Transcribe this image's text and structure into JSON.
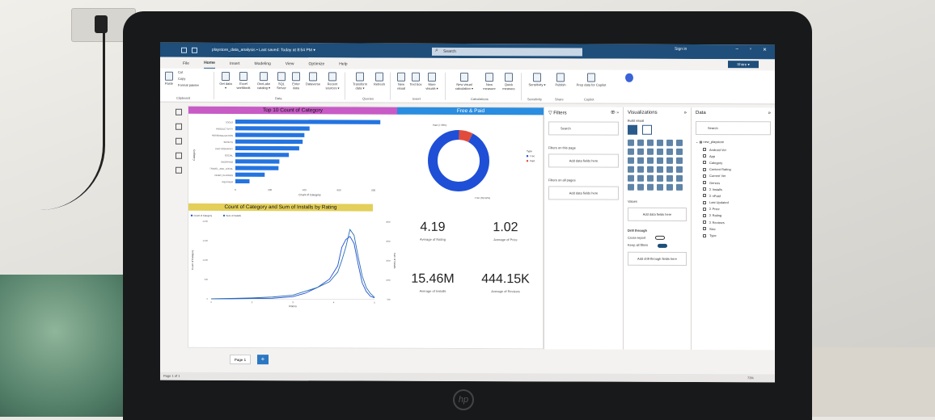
{
  "window": {
    "title": "playstore_data_analysis • Last saved: Today at 8:54 PM ▾",
    "search_placeholder": "Search",
    "sign_in": "Sign in",
    "share_label": "Share ▾"
  },
  "tabs": [
    "File",
    "Home",
    "Insert",
    "Modeling",
    "View",
    "Optimize",
    "Help"
  ],
  "ribbon": {
    "clipboard": [
      "Cut",
      "Copy",
      "Format painter",
      "Paste"
    ],
    "data_buttons": [
      "Get data ▾",
      "Excel workbook",
      "OneLake catalog ▾",
      "SQL Server",
      "Enter data",
      "Dataverse",
      "Recent sources ▾"
    ],
    "queries_buttons": [
      "Transform data ▾",
      "Refresh"
    ],
    "insert_buttons": [
      "New visual",
      "Text box",
      "More visuals ▾"
    ],
    "calc_buttons": [
      "New visual calculation ▾",
      "New measure",
      "Quick measure"
    ],
    "other_buttons": [
      "Sensitivity ▾",
      "Publish",
      "Prep data for Copilot"
    ],
    "groups": [
      "Clipboard",
      "Data",
      "Queries",
      "Insert",
      "Calculations",
      "Sensitivity",
      "Share",
      "Copilot"
    ]
  },
  "canvas": {
    "bar_title": "Top 10 Count of Category",
    "donut_title": "Free & Paid",
    "line_title": "Count of Category and Sum of Installs by Rating",
    "donut_labels": {
      "paid": "Paid (7.38%)",
      "free": "Free (92.62%)",
      "legend_title": "Type",
      "legend_free": "Free",
      "legend_paid": "Paid"
    },
    "bar_axis_x": "Count of Category",
    "bar_axis_y": "Category",
    "line_axis_x": "Rating",
    "line_axis_y": "Count of Category",
    "line_axis_y2": "Sum of Installs",
    "line_legend": [
      "Count of Category",
      "Sum of Installs"
    ],
    "kpis": [
      {
        "value": "4.19",
        "label": "Average of Rating"
      },
      {
        "value": "1.02",
        "label": "Average of Price"
      },
      {
        "value": "15.46M",
        "label": "Average of Installs"
      },
      {
        "value": "444.15K",
        "label": "Average of Reviews"
      }
    ]
  },
  "chart_data": [
    {
      "type": "bar",
      "title": "Top 10 Count of Category",
      "categories": [
        "TOOLS",
        "PRODUCTIVITY",
        "PERSONALIZATION",
        "SPORTS",
        "PHOTOGRAPHY",
        "SOCIAL",
        "SHOPPING",
        "TRAVEL_AND_LOCAL",
        "VIDEO_PLAYERS",
        "WEATHER"
      ],
      "values": [
        840,
        430,
        400,
        390,
        370,
        310,
        255,
        250,
        170,
        82
      ],
      "xlabel": "Count of Category",
      "ylabel": "Category",
      "xticks": [
        "0",
        "200",
        "400",
        "600",
        "800"
      ],
      "xlim": [
        0,
        900
      ]
    },
    {
      "type": "pie",
      "title": "Free & Paid",
      "categories": [
        "Free",
        "Paid"
      ],
      "values": [
        92.62,
        7.38
      ],
      "colors": [
        "#1f4fd6",
        "#e04b3c"
      ]
    },
    {
      "type": "line",
      "title": "Count of Category and Sum of Installs by Rating",
      "x": [
        1,
        1.5,
        2,
        2.5,
        3,
        3.3,
        3.6,
        3.9,
        4.1,
        4.2,
        4.3,
        4.4,
        4.5,
        4.6,
        4.7,
        4.8,
        4.9,
        5
      ],
      "series": [
        {
          "name": "Count of Category",
          "values": [
            0,
            2,
            10,
            18,
            60,
            150,
            300,
            520,
            860,
            1340,
            1540,
            1620,
            1440,
            900,
            420,
            200,
            80,
            40
          ]
        },
        {
          "name": "Sum of Installs",
          "values": [
            0,
            0.2,
            0.5,
            1,
            2,
            4,
            6,
            9,
            14,
            20,
            27,
            36,
            33,
            22,
            12,
            6,
            3,
            1
          ]
        }
      ],
      "xlabel": "Rating",
      "ylabel": "Count of Category",
      "y2label": "Sum of Installs",
      "xticks": [
        "1",
        "2",
        "3",
        "4",
        "5"
      ],
      "yticks": [
        "0",
        "500",
        "1,000",
        "1,500",
        "2,000"
      ],
      "ylim": [
        0,
        2000
      ],
      "y2ticks": [
        "0bn",
        "10bn",
        "20bn",
        "30bn",
        "40bn"
      ],
      "y2lim": [
        0,
        40
      ]
    }
  ],
  "filters": {
    "title": "Filters",
    "search": "Search",
    "on_page": "Filters on this page",
    "all_pages": "Filters on all pages",
    "add_fields": "Add data fields here"
  },
  "visualizations": {
    "title": "Visualizations",
    "build": "Build visual",
    "values": "Values",
    "add_fields": "Add data fields here",
    "drill": "Drill through",
    "cross_report": "Cross-report",
    "keep_filters": "Keep all filters",
    "add_drill": "Add drill-through fields here"
  },
  "data_pane": {
    "title": "Data",
    "search": "Search",
    "table": "new_playstore",
    "fields": [
      "Android Ver",
      "App",
      "Category",
      "Content Rating",
      "Current Ver",
      "Genres",
      "Σ Installs",
      "Σ nPaid",
      "Last Updated",
      "Σ Price",
      "Σ Rating",
      "Σ Reviews",
      "Size",
      "Type"
    ]
  },
  "bottom": {
    "page_tab": "Page 1",
    "add_page": "+",
    "status_left": "Page 1 of 1",
    "zoom": "73%"
  }
}
